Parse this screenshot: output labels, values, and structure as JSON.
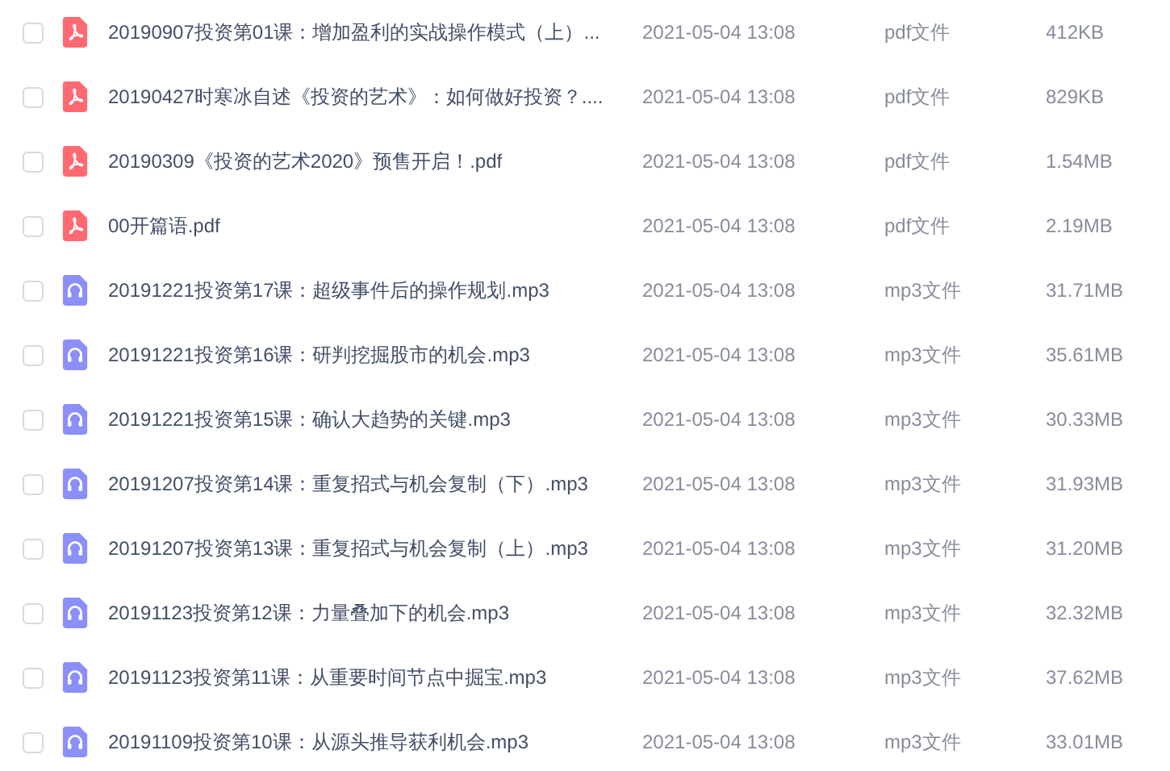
{
  "files": [
    {
      "name": "20190907投资第01课：增加盈利的实战操作模式（上）...",
      "kind": "pdf",
      "checked": false,
      "modified": "2021-05-04 13:08",
      "type": "pdf文件",
      "size": "412KB"
    },
    {
      "name": "20190427时寒冰自述《投资的艺术》：如何做好投资？....",
      "kind": "pdf",
      "checked": false,
      "modified": "2021-05-04 13:08",
      "type": "pdf文件",
      "size": "829KB"
    },
    {
      "name": "20190309《投资的艺术2020》预售开启！.pdf",
      "kind": "pdf",
      "checked": false,
      "modified": "2021-05-04 13:08",
      "type": "pdf文件",
      "size": "1.54MB"
    },
    {
      "name": "00开篇语.pdf",
      "kind": "pdf",
      "checked": false,
      "modified": "2021-05-04 13:08",
      "type": "pdf文件",
      "size": "2.19MB"
    },
    {
      "name": "20191221投资第17课：超级事件后的操作规划.mp3",
      "kind": "mp3",
      "checked": false,
      "modified": "2021-05-04 13:08",
      "type": "mp3文件",
      "size": "31.71MB"
    },
    {
      "name": "20191221投资第16课：研判挖掘股市的机会.mp3",
      "kind": "mp3",
      "checked": false,
      "modified": "2021-05-04 13:08",
      "type": "mp3文件",
      "size": "35.61MB"
    },
    {
      "name": "20191221投资第15课：确认大趋势的关键.mp3",
      "kind": "mp3",
      "checked": false,
      "modified": "2021-05-04 13:08",
      "type": "mp3文件",
      "size": "30.33MB"
    },
    {
      "name": "20191207投资第14课：重复招式与机会复制（下）.mp3",
      "kind": "mp3",
      "checked": false,
      "modified": "2021-05-04 13:08",
      "type": "mp3文件",
      "size": "31.93MB"
    },
    {
      "name": "20191207投资第13课：重复招式与机会复制（上）.mp3",
      "kind": "mp3",
      "checked": false,
      "modified": "2021-05-04 13:08",
      "type": "mp3文件",
      "size": "31.20MB"
    },
    {
      "name": "20191123投资第12课：力量叠加下的机会.mp3",
      "kind": "mp3",
      "checked": false,
      "modified": "2021-05-04 13:08",
      "type": "mp3文件",
      "size": "32.32MB"
    },
    {
      "name": "20191123投资第11课：从重要时间节点中掘宝.mp3",
      "kind": "mp3",
      "checked": false,
      "modified": "2021-05-04 13:08",
      "type": "mp3文件",
      "size": "37.62MB"
    },
    {
      "name": "20191109投资第10课：从源头推导获利机会.mp3",
      "kind": "mp3",
      "checked": false,
      "modified": "2021-05-04 13:08",
      "type": "mp3文件",
      "size": "33.01MB"
    }
  ]
}
